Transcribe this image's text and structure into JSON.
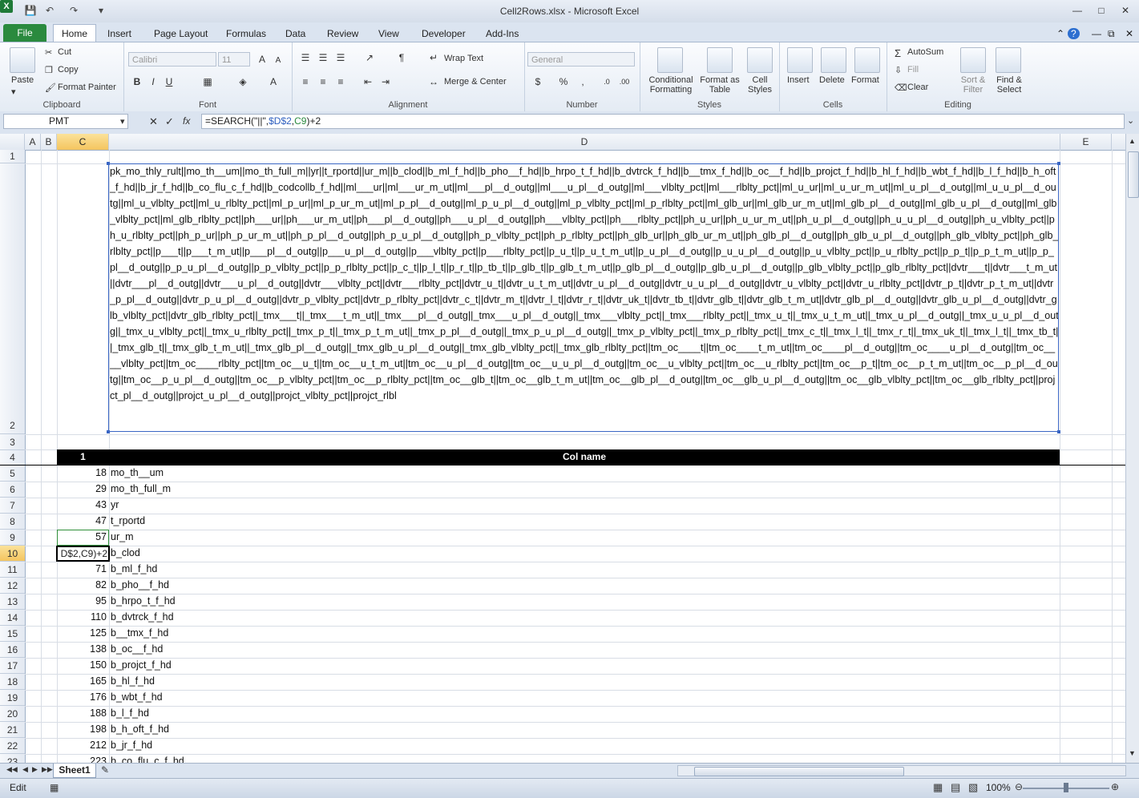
{
  "window": {
    "title": "Cell2Rows.xlsx - Microsoft Excel",
    "app_icon": "X"
  },
  "tabs": [
    "File",
    "Home",
    "Insert",
    "Page Layout",
    "Formulas",
    "Data",
    "Review",
    "View",
    "Developer",
    "Add-Ins"
  ],
  "ribbon": {
    "clipboard": {
      "label": "Clipboard",
      "paste": "Paste",
      "cut": "Cut",
      "copy": "Copy",
      "format_painter": "Format Painter"
    },
    "font": {
      "label": "Font",
      "name": "Calibri",
      "size": "11"
    },
    "alignment": {
      "label": "Alignment",
      "wrap_text": "Wrap Text",
      "merge_center": "Merge & Center"
    },
    "number": {
      "label": "Number",
      "format": "General"
    },
    "styles": {
      "label": "Styles",
      "conditional": "Conditional Formatting",
      "format_table": "Format as Table",
      "cell_styles": "Cell Styles"
    },
    "cells": {
      "label": "Cells",
      "insert": "Insert",
      "delete": "Delete",
      "format": "Format"
    },
    "editing": {
      "label": "Editing",
      "autosum": "AutoSum",
      "fill": "Fill",
      "clear": "Clear",
      "sort_filter": "Sort & Filter",
      "find_select": "Find & Select"
    }
  },
  "formula_bar": {
    "name_box": "PMT",
    "formula_parts": [
      "=SEARCH(\"||\",",
      "$D$2",
      ",",
      "C9",
      ")+2"
    ]
  },
  "columns": [
    "A",
    "B",
    "C",
    "D",
    "E"
  ],
  "cell_D2": "pk_mo_thly_rult||mo_th__um||mo_th_full_m||yr||t_rportd||ur_m||b_clod||b_ml_f_hd||b_pho__f_hd||b_hrpo_t_f_hd||b_dvtrck_f_hd||b__tmx_f_hd||b_oc__f_hd||b_projct_f_hd||b_hl_f_hd||b_wbt_f_hd||b_l_f_hd||b_h_oft_f_hd||b_jr_f_hd||b_co_flu_c_f_hd||b_codcollb_f_hd||ml___ur||ml___ur_m_ut||ml___pl__d_outg||ml___u_pl__d_outg||ml___vlblty_pct||ml___rlblty_pct||ml_u_ur||ml_u_ur_m_ut||ml_u_pl__d_outg||ml_u_u_pl__d_outg||ml_u_vlblty_pct||ml_u_rlblty_pct||ml_p_ur||ml_p_ur_m_ut||ml_p_pl__d_outg||ml_p_u_pl__d_outg||ml_p_vlblty_pct||ml_p_rlblty_pct||ml_glb_ur||ml_glb_ur_m_ut||ml_glb_pl__d_outg||ml_glb_u_pl__d_outg||ml_glb_vlblty_pct||ml_glb_rlblty_pct||ph___ur||ph___ur_m_ut||ph___pl__d_outg||ph___u_pl__d_outg||ph___vlblty_pct||ph___rlblty_pct||ph_u_ur||ph_u_ur_m_ut||ph_u_pl__d_outg||ph_u_u_pl__d_outg||ph_u_vlblty_pct||ph_u_rlblty_pct||ph_p_ur||ph_p_ur_m_ut||ph_p_pl__d_outg||ph_p_u_pl__d_outg||ph_p_vlblty_pct||ph_p_rlblty_pct||ph_glb_ur||ph_glb_ur_m_ut||ph_glb_pl__d_outg||ph_glb_u_pl__d_outg||ph_glb_vlblty_pct||ph_glb_rlblty_pct||p___t||p___t_m_ut||p___pl__d_outg||p___u_pl__d_outg||p___vlblty_pct||p___rlblty_pct||p_u_t||p_u_t_m_ut||p_u_pl__d_outg||p_u_u_pl__d_outg||p_u_vlblty_pct||p_u_rlblty_pct||p_p_t||p_p_t_m_ut||p_p_pl__d_outg||p_p_u_pl__d_outg||p_p_vlblty_pct||p_p_rlblty_pct||p_c_t||p_l_t||p_r_t||p_tb_t||p_glb_t||p_glb_t_m_ut||p_glb_pl__d_outg||p_glb_u_pl__d_outg||p_glb_vlblty_pct||p_glb_rlblty_pct||dvtr___t||dvtr___t_m_ut||dvtr___pl__d_outg||dvtr___u_pl__d_outg||dvtr___vlblty_pct||dvtr___rlblty_pct||dvtr_u_t||dvtr_u_t_m_ut||dvtr_u_pl__d_outg||dvtr_u_u_pl__d_outg||dvtr_u_vlblty_pct||dvtr_u_rlblty_pct||dvtr_p_t||dvtr_p_t_m_ut||dvtr_p_pl__d_outg||dvtr_p_u_pl__d_outg||dvtr_p_vlblty_pct||dvtr_p_rlblty_pct||dvtr_c_t||dvtr_m_t||dvtr_l_t||dvtr_r_t||dvtr_uk_t||dvtr_tb_t||dvtr_glb_t||dvtr_glb_t_m_ut||dvtr_glb_pl__d_outg||dvtr_glb_u_pl__d_outg||dvtr_glb_vlblty_pct||dvtr_glb_rlblty_pct||_tmx___t||_tmx___t_m_ut||_tmx___pl__d_outg||_tmx___u_pl__d_outg||_tmx___vlblty_pct||_tmx___rlblty_pct||_tmx_u_t||_tmx_u_t_m_ut||_tmx_u_pl__d_outg||_tmx_u_u_pl__d_outg||_tmx_u_vlblty_pct||_tmx_u_rlblty_pct||_tmx_p_t||_tmx_p_t_m_ut||_tmx_p_pl__d_outg||_tmx_p_u_pl__d_outg||_tmx_p_vlblty_pct||_tmx_p_rlblty_pct||_tmx_c_t||_tmx_l_t||_tmx_r_t||_tmx_uk_t||_tmx_l_t||_tmx_tb_t||_tmx_glb_t||_tmx_glb_t_m_ut||_tmx_glb_pl__d_outg||_tmx_glb_u_pl__d_outg||_tmx_glb_vlblty_pct||_tmx_glb_rlblty_pct||tm_oc____t||tm_oc____t_m_ut||tm_oc____pl__d_outg||tm_oc____u_pl__d_outg||tm_oc____vlblty_pct||tm_oc____rlblty_pct||tm_oc__u_t||tm_oc__u_t_m_ut||tm_oc__u_pl__d_outg||tm_oc__u_u_pl__d_outg||tm_oc__u_vlblty_pct||tm_oc__u_rlblty_pct||tm_oc__p_t||tm_oc__p_t_m_ut||tm_oc__p_pl__d_outg||tm_oc__p_u_pl__d_outg||tm_oc__p_vlblty_pct||tm_oc__p_rlblty_pct||tm_oc__glb_t||tm_oc__glb_t_m_ut||tm_oc__glb_pl__d_outg||tm_oc__glb_u_pl__d_outg||tm_oc__glb_vlblty_pct||tm_oc__glb_rlblty_pct||projct_pl__d_outg||projct_u_pl__d_outg||projct_vlblty_pct||projct_rlbl",
  "header_row": {
    "c": "1",
    "d": "Col name"
  },
  "rows": [
    {
      "n": "5",
      "c": "18",
      "d": "mo_th__um"
    },
    {
      "n": "6",
      "c": "29",
      "d": "mo_th_full_m"
    },
    {
      "n": "7",
      "c": "43",
      "d": "yr"
    },
    {
      "n": "8",
      "c": "47",
      "d": "t_rportd"
    },
    {
      "n": "9",
      "c": "57",
      "d": "ur_m"
    },
    {
      "n": "10",
      "c": "",
      "d": "b_clod"
    },
    {
      "n": "11",
      "c": "71",
      "d": "b_ml_f_hd"
    },
    {
      "n": "12",
      "c": "82",
      "d": "b_pho__f_hd"
    },
    {
      "n": "13",
      "c": "95",
      "d": "b_hrpo_t_f_hd"
    },
    {
      "n": "14",
      "c": "110",
      "d": "b_dvtrck_f_hd"
    },
    {
      "n": "15",
      "c": "125",
      "d": "b__tmx_f_hd"
    },
    {
      "n": "16",
      "c": "138",
      "d": "b_oc__f_hd"
    },
    {
      "n": "17",
      "c": "150",
      "d": "b_projct_f_hd"
    },
    {
      "n": "18",
      "c": "165",
      "d": "b_hl_f_hd"
    },
    {
      "n": "19",
      "c": "176",
      "d": "b_wbt_f_hd"
    },
    {
      "n": "20",
      "c": "188",
      "d": "b_l_f_hd"
    },
    {
      "n": "21",
      "c": "198",
      "d": "b_h_oft_f_hd"
    },
    {
      "n": "22",
      "c": "212",
      "d": "b_jr_f_hd"
    },
    {
      "n": "23",
      "c": "223",
      "d": "b_co_flu_c_f_hd"
    }
  ],
  "editing_cell": "D$2,C9)+2",
  "sheet_tab": "Sheet1",
  "status": {
    "mode": "Edit",
    "zoom": "100%"
  },
  "colors": {
    "file_tab": "#2a8a3e",
    "selection": "#3a66c4",
    "header_fill": "#000000"
  }
}
